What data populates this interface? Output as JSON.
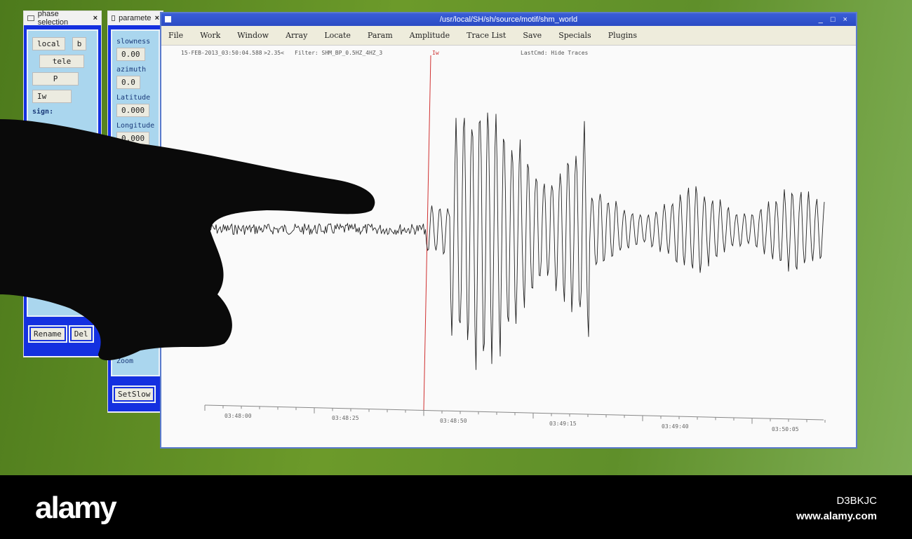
{
  "phase_panel": {
    "title": "phase selection",
    "local": "local",
    "local_opt": "b",
    "tele": "tele",
    "phase": "P",
    "name": "Iw",
    "sign_label": "sign:",
    "rename": "Rename",
    "del": "Del"
  },
  "param_panel": {
    "title": "paramete",
    "slowness_label": "slowness",
    "slowness": "0.00",
    "azimuth_label": "azimuth",
    "azimuth": "0.0",
    "latitude_label": "Latitude",
    "latitude": "0.000",
    "longitude_label": "Longitude",
    "longitude": "0.000",
    "zoom": "Zoom",
    "setslow": "SetSlow"
  },
  "main": {
    "title": "/usr/local/SH/sh/source/motif/shm_world",
    "controls": "_ □ ×",
    "menu": [
      "File",
      "Work",
      "Window",
      "Array",
      "Locate",
      "Param",
      "Amplitude",
      "Trace List",
      "Save",
      "Specials",
      "Plugins"
    ],
    "timestamp": "15-FEB-2013_03:50:04.588",
    "value": ">2.35<",
    "filter": "Filter: SHM_BP_0.5HZ_4HZ_3",
    "lastcmd": "LastCmd: Hide Traces",
    "phase_marker": "Iw",
    "ticks": [
      "03:48:00",
      "03:48:25",
      "03:48:50",
      "03:49:15",
      "03:49:40",
      "03:50:05"
    ]
  },
  "footer": {
    "logo": "alamy",
    "code": "D3BKJC",
    "url": "www.alamy.com"
  },
  "colors": {
    "window_blue": "#1430e0",
    "marker_red": "#d03030"
  }
}
